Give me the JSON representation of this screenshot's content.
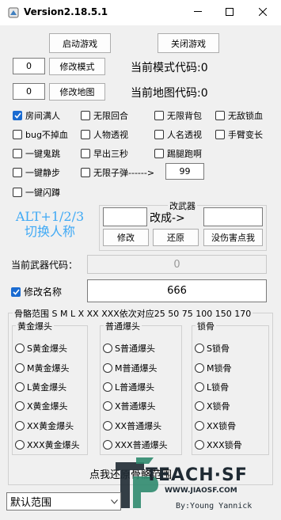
{
  "window": {
    "title": "Version2.18.5.1",
    "icon": "tools-app-icon",
    "controls": {
      "minimize": "—",
      "maximize": "☐",
      "close": "✕"
    }
  },
  "game": {
    "start_label": "启动游戏",
    "stop_label": "关闭游戏"
  },
  "mode": {
    "value": "0",
    "button_label": "修改模式",
    "status_text": "当前模式代码:0"
  },
  "map": {
    "value": "0",
    "button_label": "修改地图",
    "status_text": "当前地图代码:0"
  },
  "checkboxes": [
    {
      "label": "房间满人",
      "checked": true
    },
    {
      "label": "无限回合",
      "checked": false
    },
    {
      "label": "无限背包",
      "checked": false
    },
    {
      "label": "无敌锁血",
      "checked": false
    },
    {
      "label": "bug不掉血",
      "checked": false
    },
    {
      "label": "人物透视",
      "checked": false
    },
    {
      "label": "人名透视",
      "checked": false
    },
    {
      "label": "手臂变长",
      "checked": false
    },
    {
      "label": "一键鬼跳",
      "checked": false
    },
    {
      "label": "早出三秒",
      "checked": false
    },
    {
      "label": "踢腿跑啊",
      "checked": false
    },
    {
      "label": "一键静步",
      "checked": false
    },
    {
      "label": "无限子弹------>",
      "checked": false
    },
    {
      "label": "一键闪蹲",
      "checked": false
    }
  ],
  "ammo_value": "99",
  "hotkey_hint": {
    "line1": "ALT+1/2/3",
    "line2": "切换人称"
  },
  "weapon": {
    "group_title": "改武器",
    "arrow_label": "改成->",
    "from_value": "",
    "to_value": "",
    "modify_label": "修改",
    "restore_label": "还原",
    "no_damage_label": "没伤害点我",
    "current_label": "当前武器代码：",
    "current_value": "0"
  },
  "rename": {
    "checkbox_label": "修改名称",
    "checked": true,
    "value": "666"
  },
  "bone_range": {
    "title": "骨骼范围 S M L X XX XXX依次对应25 50 75 100 150 170",
    "groups": [
      {
        "title": "黄金爆头",
        "options": [
          "S黄金爆头",
          "M黄金爆头",
          "L黄金爆头",
          "X黄金爆头",
          "XX黄金爆头",
          "XXX黄金爆头"
        ]
      },
      {
        "title": "普通爆头",
        "options": [
          "S普通爆头",
          "M普通爆头",
          "L普通爆头",
          "X普通爆头",
          "XX普通爆头",
          "XXX普通爆头"
        ]
      },
      {
        "title": "锁骨",
        "options": [
          "S锁骨",
          "M锁骨",
          "L锁骨",
          "X锁骨",
          "XX锁骨",
          "XXX锁骨"
        ]
      }
    ],
    "restore_hint": "点我还原骨骼范围"
  },
  "range_select": {
    "value": "默认范围"
  },
  "watermark": {
    "logo_text": "TEACH·SF",
    "url": "WWW.JIAOSF.COM",
    "author": "By:Young Yannick"
  },
  "colors": {
    "accent": "#1a6bd1",
    "hint_text": "#3fa9f5",
    "logo_green": "#2f8a6e"
  }
}
